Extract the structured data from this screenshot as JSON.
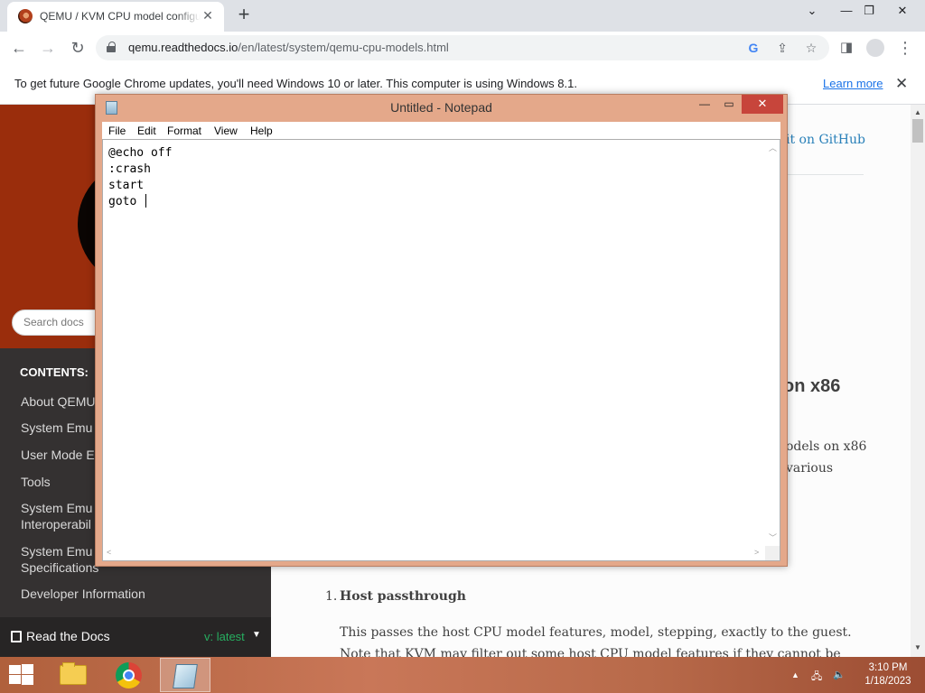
{
  "browser": {
    "tab": {
      "title": "QEMU / KVM CPU model configuration — QEMU documentation",
      "close_glyph": "✕"
    },
    "new_tab_glyph": "+",
    "window_controls": {
      "dropdown": "⌄",
      "minimize": "—",
      "restore": "❐",
      "close": "✕"
    },
    "nav": {
      "back": "←",
      "forward": "→",
      "reload": "↻"
    },
    "address": {
      "domain": "qemu.readthedocs.io",
      "path": "/en/latest/system/qemu-cpu-models.html"
    },
    "toolbar_icons": [
      "google-lens-icon",
      "share-icon",
      "bookmark-star-icon",
      "side-panel-icon",
      "profile-icon",
      "menu-icon"
    ],
    "infobar": {
      "message": "To get future Google Chrome updates, you'll need Windows 10 or later. This computer is using Windows 8.1.",
      "link": "Learn more",
      "close_glyph": "✕"
    }
  },
  "docs": {
    "search_placeholder": "Search docs",
    "contents_caption": "CONTENTS:",
    "nav_items": [
      "About QEMU",
      "System Emulation",
      "User Mode Emulation",
      "Tools",
      "System Emulation Guest Hardware Specifications / Interoperability",
      "System Emulation Guest Hardware Specifications",
      "Developer Information"
    ],
    "nav_items_visible": [
      "About QEMU",
      "System Emu",
      "User Mode E",
      "Tools",
      "System Emu\nInteroperabil",
      "System Emu\nSpecifications",
      "Developer Information"
    ],
    "rtd_label": "Read the Docs",
    "version": "v: latest",
    "github_link": "Edit on GitHub",
    "github_visible": "it on GitHub",
    "heading_visible": "on x86",
    "para_line1_visible": "odels on x86",
    "para_line2_visible": "various",
    "list_item_number": "1.",
    "list_item_title": "Host passthrough",
    "list_item_body": "This passes the host CPU model features, model, stepping, exactly to the guest. Note that KVM may filter out some host CPU model features if they cannot be supported with"
  },
  "notepad": {
    "title": "Untitled - Notepad",
    "menu": [
      "File",
      "Edit",
      "Format",
      "View",
      "Help"
    ],
    "lines": [
      "@echo off",
      ":crash",
      "start",
      "goto "
    ],
    "controls": {
      "minimize": "—",
      "maximize": "▭",
      "close": "✕"
    }
  },
  "taskbar": {
    "apps": [
      "file-explorer",
      "google-chrome",
      "notepad"
    ],
    "active_app": "notepad",
    "clock_time": "3:10 PM",
    "clock_date": "1/18/2023"
  },
  "colors": {
    "rtd_sidebar_top": "#9a2d0c",
    "rtd_sidebar_nav": "#343131",
    "notepad_frame": "#e4a88a",
    "notepad_close": "#c7453b",
    "link_blue": "#1a73e8"
  }
}
